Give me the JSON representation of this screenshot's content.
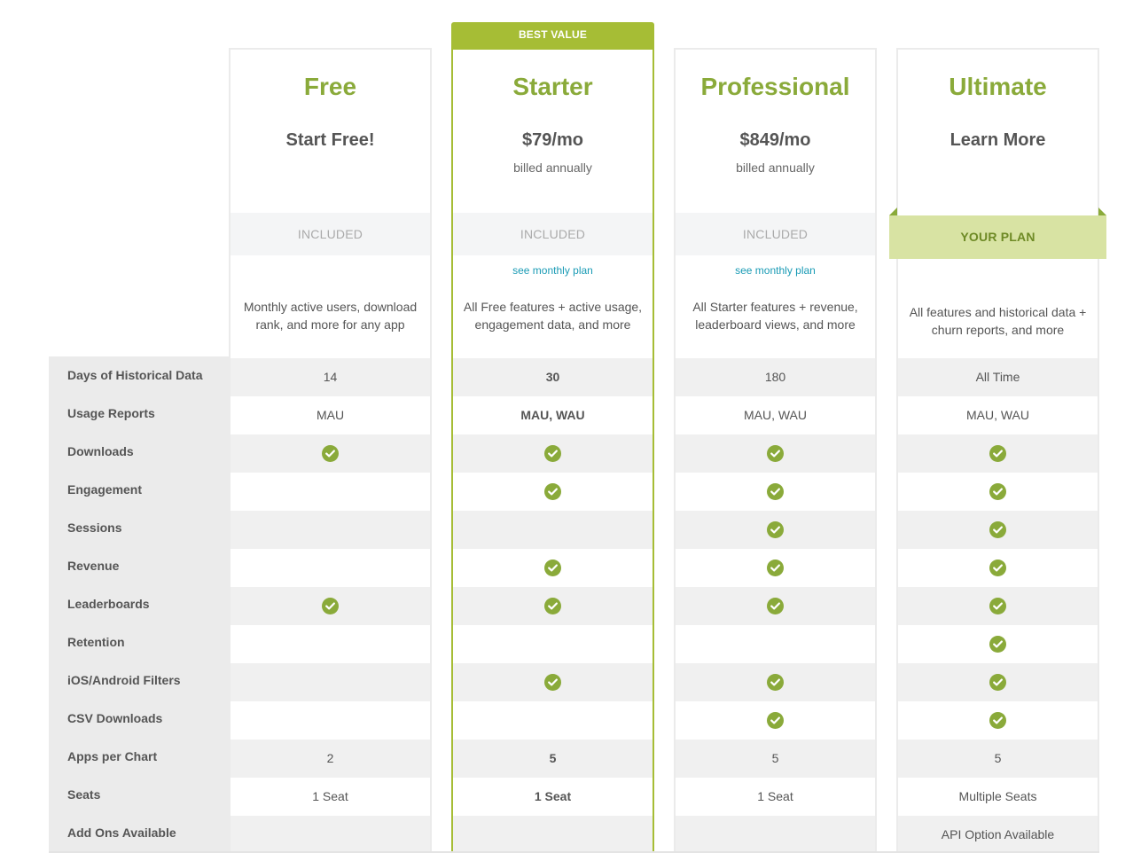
{
  "badge": {
    "best_value": "BEST VALUE"
  },
  "your_plan_label": "YOUR PLAN",
  "colors": {
    "accent": "#8aaa3a",
    "featured_border": "#a6bd35",
    "link": "#1a9bb5",
    "your_plan_bg": "#d8e3a3"
  },
  "features": [
    "Days of Historical Data",
    "Usage Reports",
    "Downloads",
    "Engagement",
    "Sessions",
    "Revenue",
    "Leaderboards",
    "Retention",
    "iOS/Android Filters",
    "CSV Downloads",
    "Apps per Chart",
    "Seats",
    "Add Ons Available"
  ],
  "plans": [
    {
      "name": "Free",
      "price": "Start Free!",
      "billing": "",
      "included": "INCLUDED",
      "monthly_link": "",
      "description": "Monthly active users, download rank, and more for any app",
      "values": [
        "14",
        "MAU",
        "check",
        "",
        "",
        "",
        "check",
        "",
        "",
        "",
        "2",
        "1 Seat",
        ""
      ]
    },
    {
      "name": "Starter",
      "price": "$79/mo",
      "billing": "billed annually",
      "included": "INCLUDED",
      "monthly_link": "see monthly plan",
      "description": "All Free features + active usage, engagement data, and more",
      "values": [
        "30",
        "MAU, WAU",
        "check",
        "check",
        "",
        "check",
        "check",
        "",
        "check",
        "",
        "5",
        "1 Seat",
        ""
      ]
    },
    {
      "name": "Professional",
      "price": "$849/mo",
      "billing": "billed annually",
      "included": "INCLUDED",
      "monthly_link": "see monthly plan",
      "description": "All Starter features + revenue, leaderboard views, and more",
      "values": [
        "180",
        "MAU, WAU",
        "check",
        "check",
        "check",
        "check",
        "check",
        "",
        "check",
        "check",
        "5",
        "1 Seat",
        ""
      ]
    },
    {
      "name": "Ultimate",
      "price": "Learn More",
      "billing": "",
      "included": "",
      "monthly_link": "",
      "description": "All features and historical data + churn reports, and more",
      "values": [
        "All Time",
        "MAU, WAU",
        "check",
        "check",
        "check",
        "check",
        "check",
        "check",
        "check",
        "check",
        "5",
        "Multiple Seats",
        "API Option Available"
      ]
    }
  ]
}
